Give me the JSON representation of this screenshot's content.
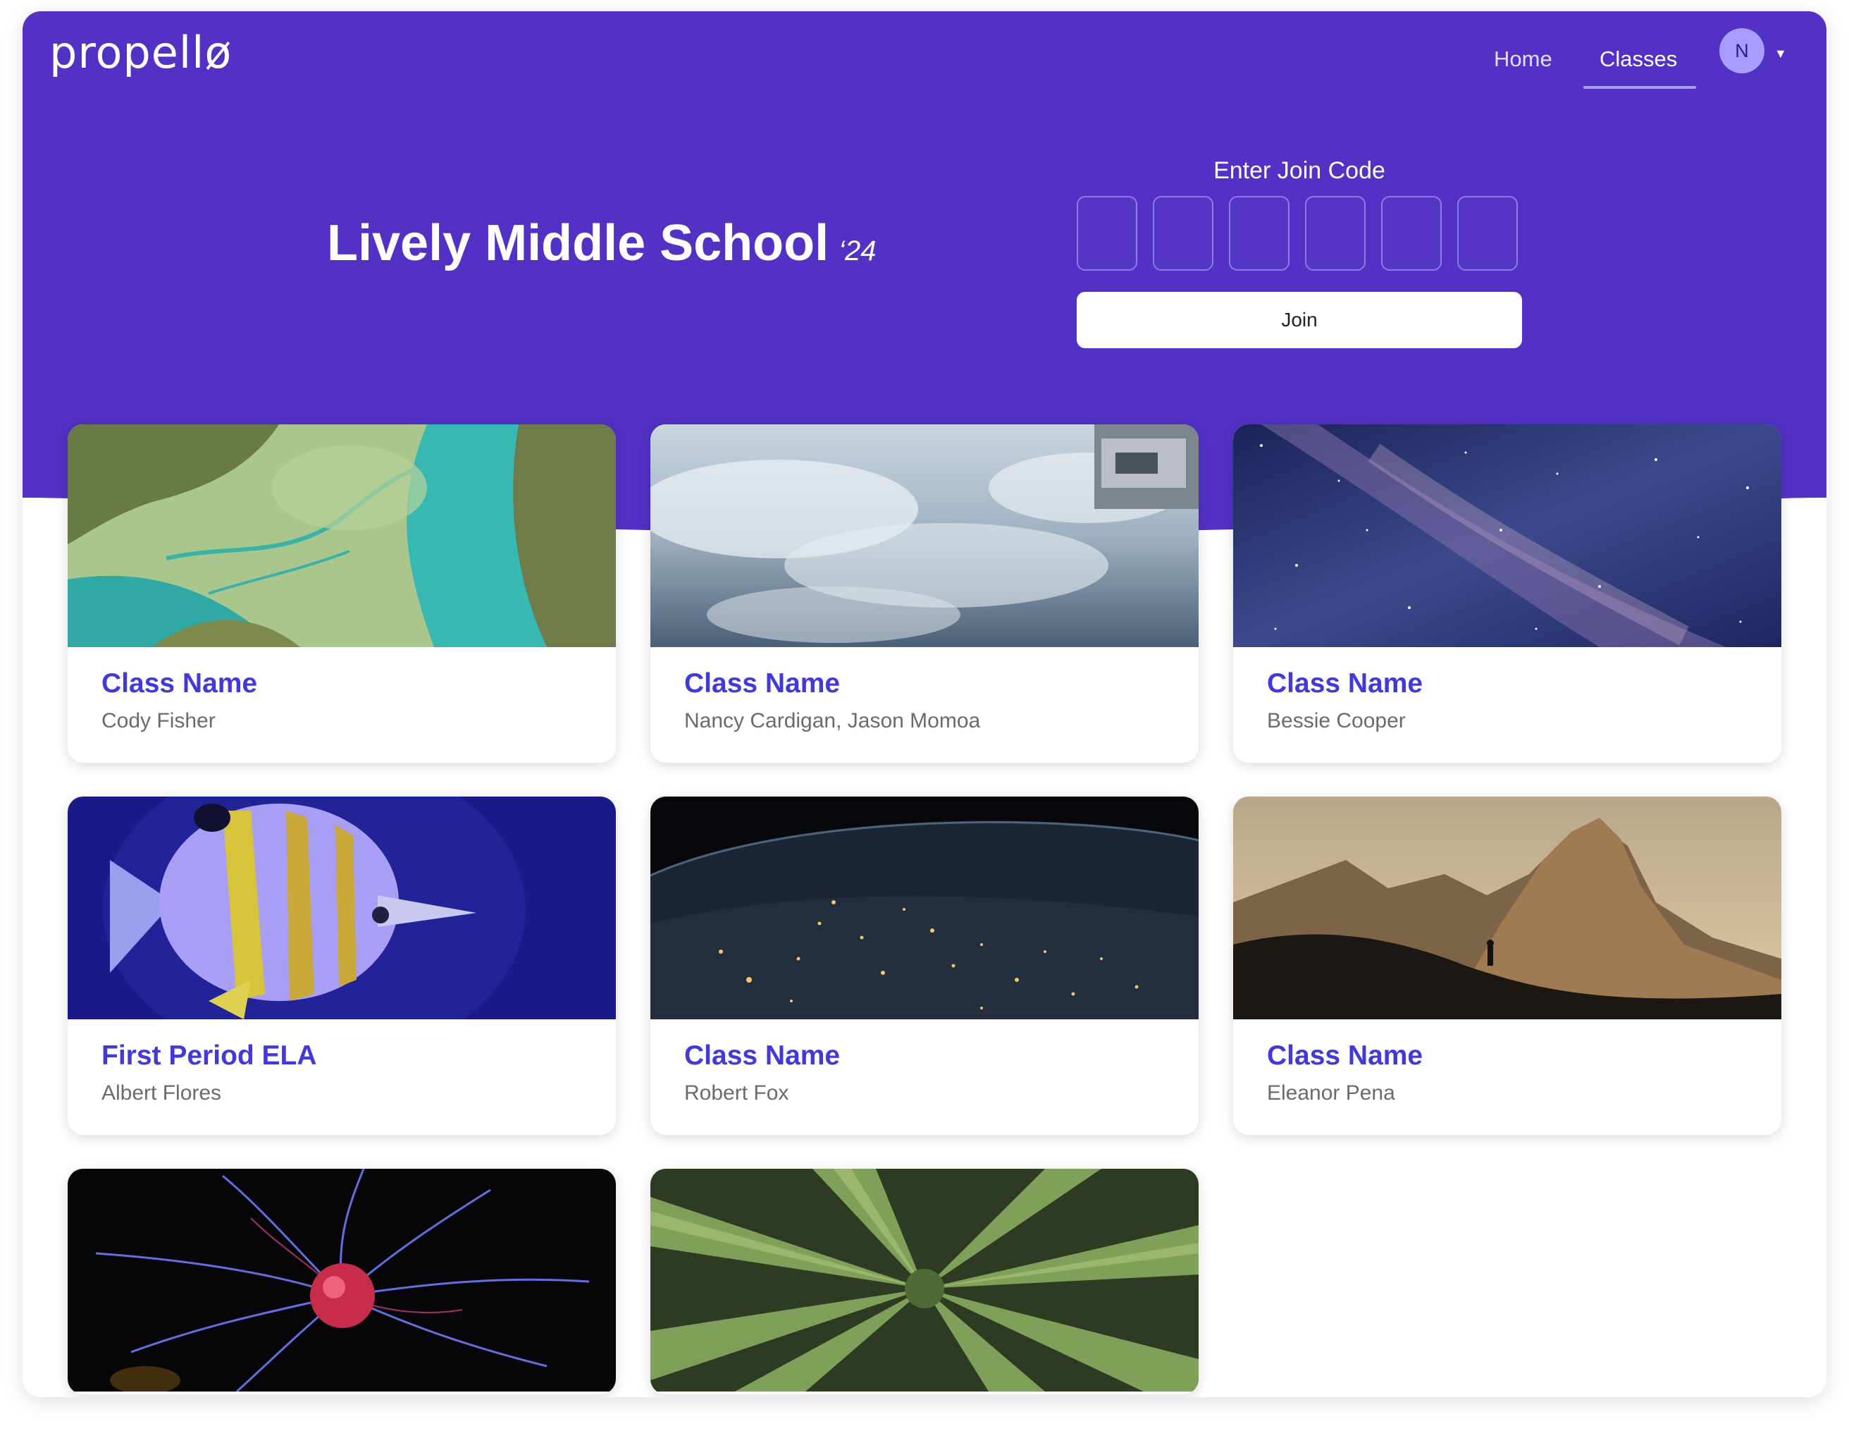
{
  "header": {
    "logo_text": "propellø",
    "nav": {
      "home": "Home",
      "classes": "Classes"
    },
    "avatar_initial": "N",
    "accent_color": "#5231c4"
  },
  "hero": {
    "school_name": "Lively Middle School",
    "year": "‘24",
    "join_label": "Enter Join Code",
    "join_button": "Join",
    "code_box_count": 6
  },
  "classes": [
    {
      "name": "Class Name",
      "teacher": "Cody Fisher",
      "image": "aerial-coastline-image"
    },
    {
      "name": "Class Name",
      "teacher": "Nancy Cardigan, Jason Momoa",
      "image": "earth-from-space-image"
    },
    {
      "name": "Class Name",
      "teacher": "Bessie Cooper",
      "image": "milky-way-image"
    },
    {
      "name": "First Period ELA",
      "teacher": "Albert Flores",
      "image": "butterflyfish-image"
    },
    {
      "name": "Class Name",
      "teacher": "Robert Fox",
      "image": "earth-at-night-image"
    },
    {
      "name": "Class Name",
      "teacher": "Eleanor Pena",
      "image": "mountain-silhouette-image"
    },
    {
      "name": "",
      "teacher": "",
      "image": "plasma-ball-image"
    },
    {
      "name": "",
      "teacher": "",
      "image": "aloe-plant-image"
    }
  ]
}
